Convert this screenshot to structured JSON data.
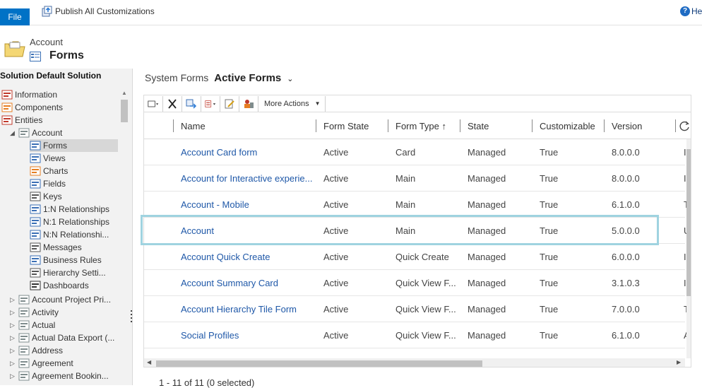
{
  "topbar": {
    "file_label": "File",
    "publish_label": "Publish All Customizations",
    "help_label": "He"
  },
  "header": {
    "entity": "Account",
    "title": "Forms"
  },
  "sidebar": {
    "solution_title": "Solution Default Solution",
    "items": [
      {
        "label": "Information",
        "icon": "information-icon",
        "indent": 0
      },
      {
        "label": "Components",
        "icon": "components-icon",
        "indent": 0
      },
      {
        "label": "Entities",
        "icon": "entities-icon",
        "indent": 1,
        "expander": "◢"
      },
      {
        "label": "Account",
        "icon": "entity-icon",
        "indent": 2,
        "expander": "◢"
      },
      {
        "label": "Forms",
        "icon": "forms-icon",
        "indent": 3,
        "selected": true
      },
      {
        "label": "Views",
        "icon": "views-icon",
        "indent": 3
      },
      {
        "label": "Charts",
        "icon": "charts-icon",
        "indent": 3
      },
      {
        "label": "Fields",
        "icon": "fields-icon",
        "indent": 3
      },
      {
        "label": "Keys",
        "icon": "keys-icon",
        "indent": 3
      },
      {
        "label": "1:N Relationships",
        "icon": "relationship-icon",
        "indent": 3
      },
      {
        "label": "N:1 Relationships",
        "icon": "relationship-icon",
        "indent": 3
      },
      {
        "label": "N:N Relationshi...",
        "icon": "relationship-icon",
        "indent": 3
      },
      {
        "label": "Messages",
        "icon": "messages-icon",
        "indent": 3
      },
      {
        "label": "Business Rules",
        "icon": "business-rules-icon",
        "indent": 3
      },
      {
        "label": "Hierarchy Setti...",
        "icon": "hierarchy-icon",
        "indent": 3
      },
      {
        "label": "Dashboards",
        "icon": "dashboards-icon",
        "indent": 3
      },
      {
        "label": "Account Project Pri...",
        "icon": "entity-icon",
        "indent": 2,
        "expander": "▷"
      },
      {
        "label": "Activity",
        "icon": "entity-icon",
        "indent": 2,
        "expander": "▷"
      },
      {
        "label": "Actual",
        "icon": "entity-icon",
        "indent": 2,
        "expander": "▷"
      },
      {
        "label": "Actual Data Export (...",
        "icon": "entity-icon",
        "indent": 2,
        "expander": "▷"
      },
      {
        "label": "Address",
        "icon": "entity-icon",
        "indent": 2,
        "expander": "▷"
      },
      {
        "label": "Agreement",
        "icon": "entity-icon",
        "indent": 2,
        "expander": "▷"
      },
      {
        "label": "Agreement Bookin...",
        "icon": "entity-icon",
        "indent": 2,
        "expander": "▷"
      }
    ]
  },
  "view": {
    "system_label": "System Forms",
    "active_label": "Active Forms"
  },
  "toolbar": {
    "more_actions": "More Actions"
  },
  "grid": {
    "columns": [
      "Name",
      "Form State",
      "Form Type ↑",
      "State",
      "Customizable",
      "Version"
    ],
    "rows": [
      [
        "Account Card form",
        "Active",
        "Card",
        "Managed",
        "True",
        "8.0.0.0",
        "I"
      ],
      [
        "Account for Interactive experie...",
        "Active",
        "Main",
        "Managed",
        "True",
        "8.0.0.0",
        "I"
      ],
      [
        "Account - Mobile",
        "Active",
        "Main",
        "Managed",
        "True",
        "6.1.0.0",
        "T"
      ],
      [
        "Account",
        "Active",
        "Main",
        "Managed",
        "True",
        "5.0.0.0",
        "U"
      ],
      [
        "Account Quick Create",
        "Active",
        "Quick Create",
        "Managed",
        "True",
        "6.0.0.0",
        "I"
      ],
      [
        "Account Summary Card",
        "Active",
        "Quick View F...",
        "Managed",
        "True",
        "3.1.0.3",
        "I"
      ],
      [
        "Account Hierarchy Tile Form",
        "Active",
        "Quick View F...",
        "Managed",
        "True",
        "7.0.0.0",
        "T"
      ],
      [
        "Social Profiles",
        "Active",
        "Quick View F...",
        "Managed",
        "True",
        "6.1.0.0",
        "A"
      ]
    ],
    "status": "1 - 11 of 11 (0 selected)"
  }
}
